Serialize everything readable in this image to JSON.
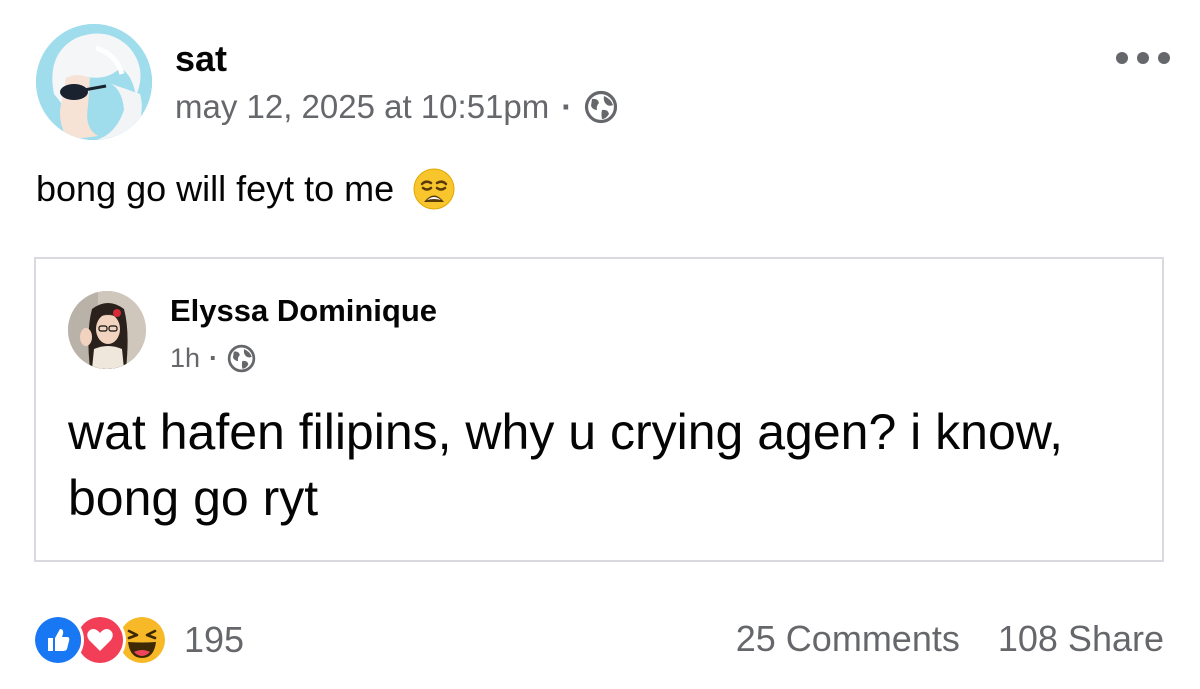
{
  "post": {
    "author": "sat",
    "timestamp": "may 12, 2025 at 10:51pm",
    "separator": "·",
    "privacy_icon": "globe-icon",
    "text": "bong go will feyt to me",
    "emoji": "weary-face-emoji",
    "more_icon": "more-options-icon"
  },
  "shared": {
    "author": "Elyssa Dominique",
    "time": "1h",
    "separator": "·",
    "privacy_icon": "globe-icon",
    "text": "wat hafen filipins, why u crying agen? i know, bong go ryt"
  },
  "footer": {
    "reaction_icons": [
      "like-icon",
      "love-icon",
      "haha-icon"
    ],
    "reaction_count": "195",
    "comments": "25 Comments",
    "shares": "108 Share"
  },
  "colors": {
    "text": "#050505",
    "muted": "#65676b",
    "like": "#1877f2",
    "love": "#f33e58",
    "haha": "#f7b928",
    "card_border": "#d8dadf"
  }
}
